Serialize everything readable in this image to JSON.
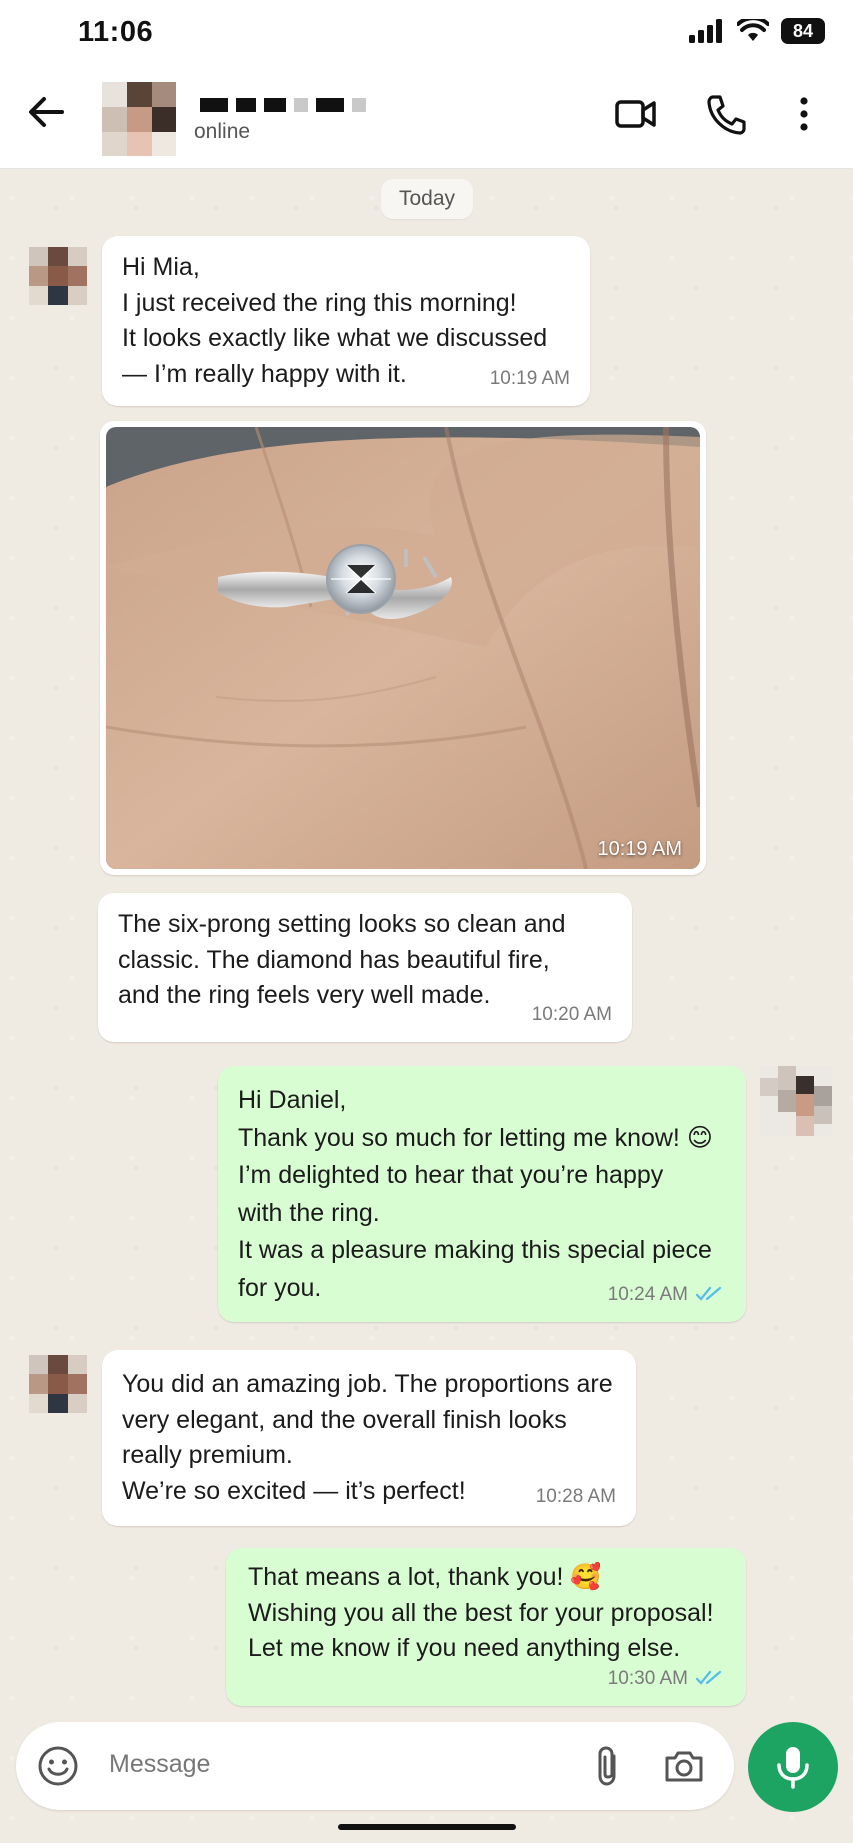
{
  "status_bar": {
    "time": "11:06",
    "battery": "84"
  },
  "header": {
    "contact_status": "online"
  },
  "date_chip": "Today",
  "messages": [
    {
      "direction": "in",
      "text": "Hi Mia,\nI just received the ring this morning!\nIt looks exactly like what we discussed\n— I’m really happy with it.",
      "time": "10:19 AM"
    },
    {
      "direction": "in",
      "type": "image",
      "image_desc": "hand wearing six-prong solitaire diamond ring",
      "time": "10:19 AM"
    },
    {
      "direction": "in",
      "text": "The six-prong setting looks so clean and\nclassic. The diamond has beautiful fire,\nand the ring feels very well made.",
      "time": "10:20 AM"
    },
    {
      "direction": "out",
      "text": "Hi Daniel,\nThank you so much for letting me know! 😊\nI’m delighted to hear that you’re happy\nwith the ring.\nIt was a pleasure making this special piece\nfor you.",
      "time": "10:24 AM",
      "read": true
    },
    {
      "direction": "in",
      "text": "You did an amazing job. The proportions are\nvery elegant, and the overall finish looks\nreally premium.\nWe’re so excited — it’s perfect!",
      "time": "10:28 AM"
    },
    {
      "direction": "out",
      "text": "That means a lot, thank you! 🥰\nWishing you all the best for your proposal!\nLet me know if you need anything else.",
      "time": "10:30 AM",
      "read": true
    }
  ],
  "input": {
    "placeholder": "Message"
  },
  "icons": {
    "back": "arrow-left-icon",
    "video": "video-call-icon",
    "call": "phone-icon",
    "menu": "more-vertical-icon",
    "emoji": "emoji-icon",
    "attach": "paperclip-icon",
    "camera": "camera-icon",
    "mic": "microphone-icon",
    "read_receipt": "double-check-icon"
  },
  "colors": {
    "outgoing_bubble": "#d9fdd3",
    "incoming_bubble": "#ffffff",
    "mic_button": "#1da463",
    "read_tick": "#53bdeb",
    "chat_background": "#efeae2"
  }
}
